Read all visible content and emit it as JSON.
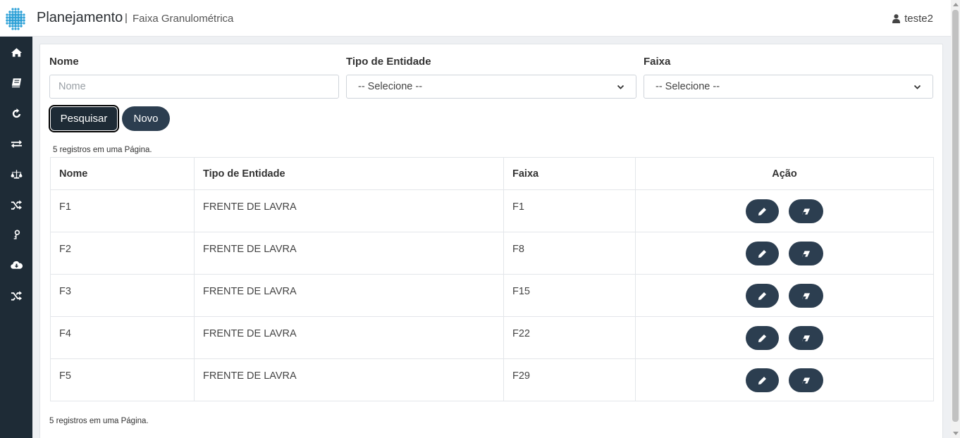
{
  "header": {
    "app_title": "Planejamento",
    "separator": "|",
    "subtitle": "Faixa Granulométrica",
    "user_name": "teste2",
    "logo_icon": "dots-globe-logo",
    "user_icon": "user-icon"
  },
  "sidebar": {
    "items": [
      {
        "icon": "home-icon"
      },
      {
        "icon": "book-icon"
      },
      {
        "icon": "refresh-icon"
      },
      {
        "icon": "exchange-icon"
      },
      {
        "icon": "balance-icon"
      },
      {
        "icon": "shuffle-icon"
      },
      {
        "icon": "key-icon"
      },
      {
        "icon": "cloud-download-icon"
      },
      {
        "icon": "shuffle-icon"
      }
    ]
  },
  "filters": {
    "nome_label": "Nome",
    "nome_placeholder": "Nome",
    "nome_value": "",
    "tipo_label": "Tipo de Entidade",
    "tipo_selected": "-- Selecione --",
    "faixa_label": "Faixa",
    "faixa_selected": "-- Selecione --"
  },
  "actions": {
    "search_label": "Pesquisar",
    "new_label": "Novo"
  },
  "records_info_top": "5 registros em uma Página.",
  "records_info_bottom": "5 registros em uma Página.",
  "table": {
    "columns": [
      "Nome",
      "Tipo de Entidade",
      "Faixa",
      "Ação"
    ],
    "rows": [
      {
        "nome": "F1",
        "tipo": "FRENTE DE LAVRA",
        "faixa": "F1"
      },
      {
        "nome": "F2",
        "tipo": "FRENTE DE LAVRA",
        "faixa": "F8"
      },
      {
        "nome": "F3",
        "tipo": "FRENTE DE LAVRA",
        "faixa": "F15"
      },
      {
        "nome": "F4",
        "tipo": "FRENTE DE LAVRA",
        "faixa": "F22"
      },
      {
        "nome": "F5",
        "tipo": "FRENTE DE LAVRA",
        "faixa": "F29"
      }
    ],
    "row_action_icons": [
      "pencil-icon",
      "eraser-icon"
    ]
  },
  "colors": {
    "sidebar_bg": "#1e2b36",
    "button_bg": "#2c3e50",
    "page_bg": "#eef0f3",
    "logo_accent": "#2a9fd6"
  }
}
